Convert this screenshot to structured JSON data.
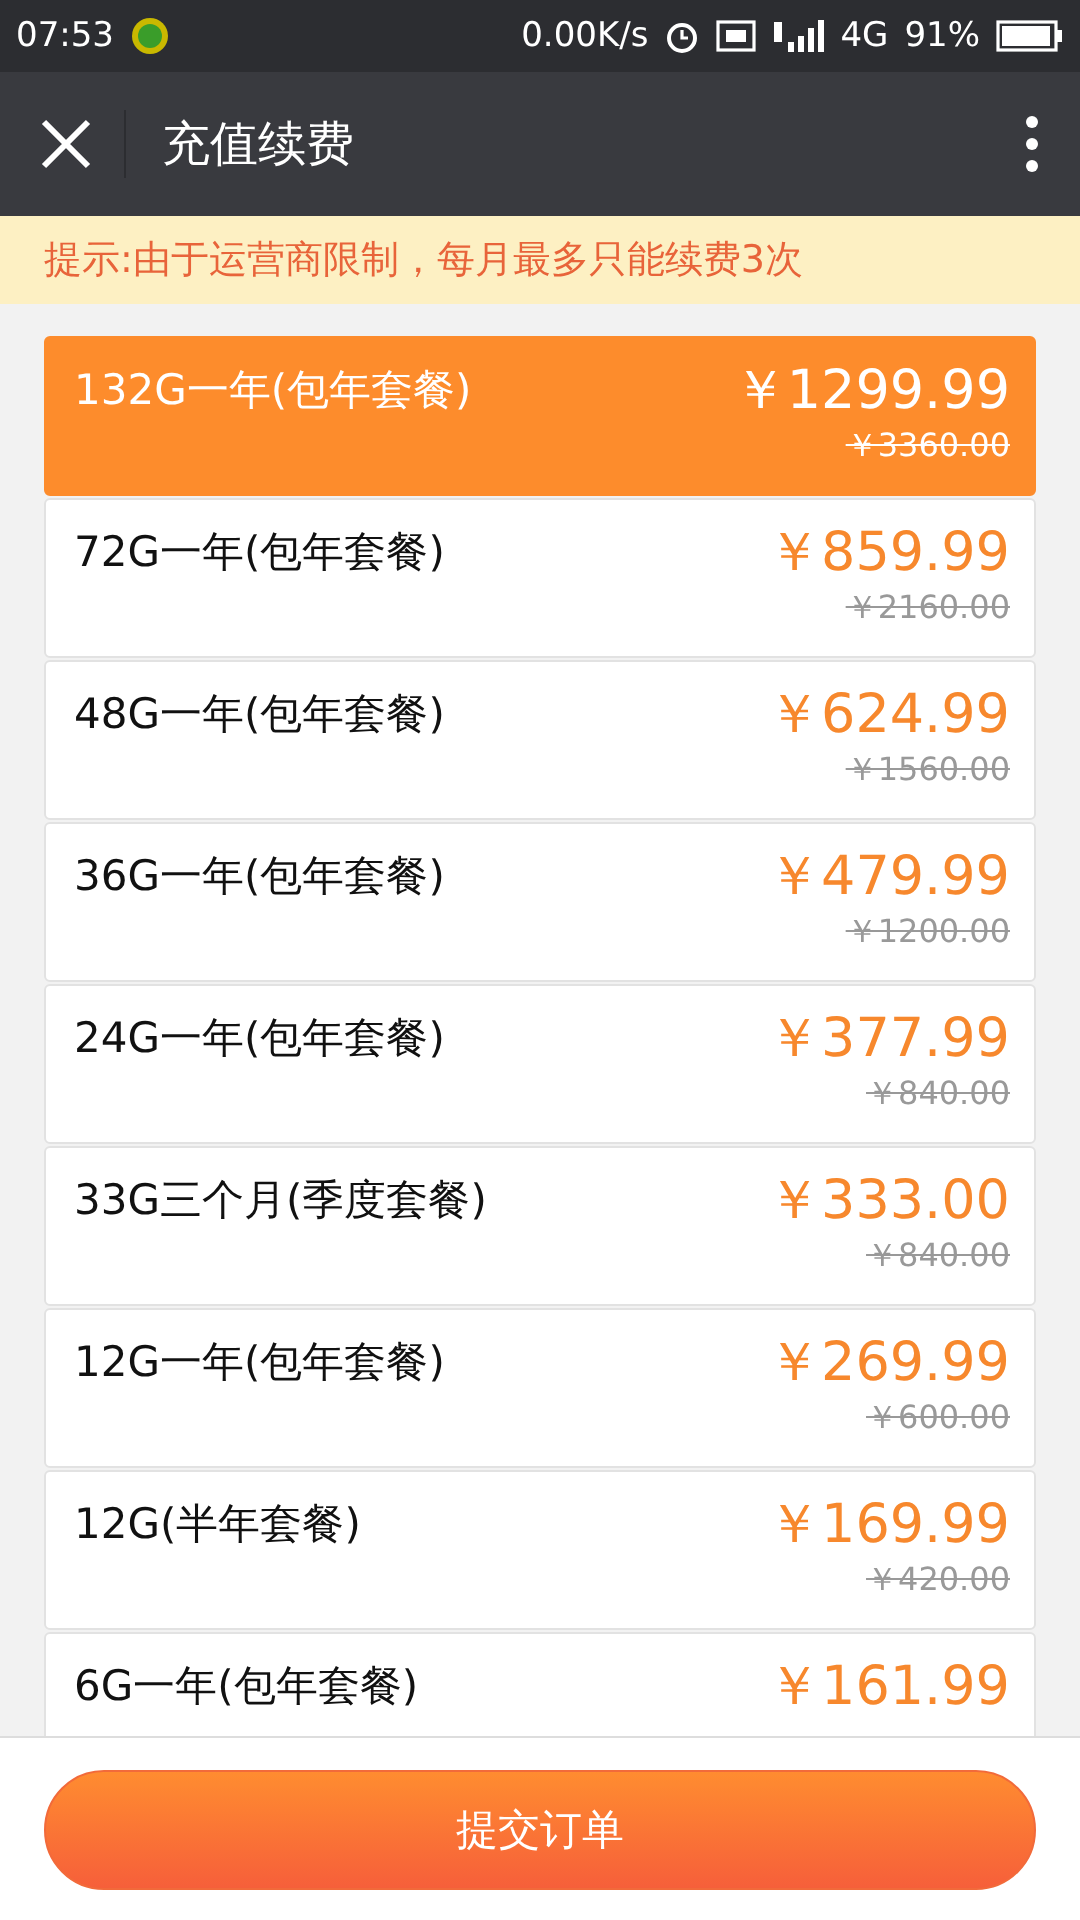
{
  "status_bar": {
    "time": "07:53",
    "speed": "0.00K/s",
    "network": "4G",
    "battery": "91%"
  },
  "header": {
    "title": "充值续费"
  },
  "notice": "提示:由于运营商限制，每月最多只能续费3次",
  "plans": [
    {
      "name": "132G一年(包年套餐)",
      "price": "￥1299.99",
      "original_price": "￥3360.00",
      "selected": true
    },
    {
      "name": "72G一年(包年套餐)",
      "price": "￥859.99",
      "original_price": "￥2160.00",
      "selected": false
    },
    {
      "name": "48G一年(包年套餐)",
      "price": "￥624.99",
      "original_price": "￥1560.00",
      "selected": false
    },
    {
      "name": "36G一年(包年套餐)",
      "price": "￥479.99",
      "original_price": "￥1200.00",
      "selected": false
    },
    {
      "name": "24G一年(包年套餐)",
      "price": "￥377.99",
      "original_price": "￥840.00",
      "selected": false
    },
    {
      "name": "33G三个月(季度套餐)",
      "price": "￥333.00",
      "original_price": "￥840.00",
      "selected": false
    },
    {
      "name": "12G一年(包年套餐)",
      "price": "￥269.99",
      "original_price": "￥600.00",
      "selected": false
    },
    {
      "name": "12G(半年套餐)",
      "price": "￥169.99",
      "original_price": "￥420.00",
      "selected": false
    },
    {
      "name": "6G一年(包年套餐)",
      "price": "￥161.99",
      "selected": false
    }
  ],
  "submit_button": "提交订单"
}
